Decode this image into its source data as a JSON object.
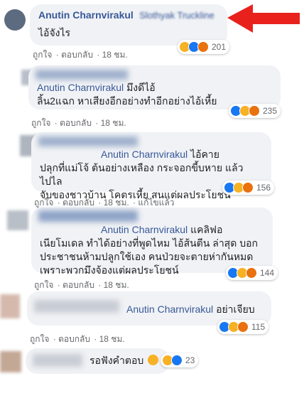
{
  "comments": [
    {
      "author": "Anutin Charnvirakul",
      "mention": "Slothyak Truckline",
      "text": "ไอ้จังไร",
      "actions": {
        "like": "ถูกใจ",
        "reply": "ตอบกลับ",
        "time": "18 ชม."
      },
      "reaction_count": "201"
    },
    {
      "author": "Slothyak Truckline",
      "mention": "Anutin Charnvirakul",
      "text_line1": "มึงดีไอ้",
      "text_line2": "ลิ้น2แฉก หาเสียงอีกอย่างทำอีกอย่างไอ้เหี้ย",
      "actions": {
        "like": "ถูกใจ",
        "reply": "ตอบกลับ",
        "time": "18 ชม."
      },
      "reaction_count": "235"
    },
    {
      "author": "Slothyak Truckline",
      "mention": "Anutin Charnvirakul",
      "text_line1": "ไอ้คาย",
      "text_line2": "ปลุกที่แม่โจ้ ต้นอย่างเหลือง กระจอกขี้บหาย แล้วไปไล",
      "text_line3": "จับของชาวบ้าน โคตรเหี้ย สนแต่ผลประโยชน์",
      "actions": {
        "like": "ถูกใจ",
        "reply": "ตอบกลับ",
        "time": "18 ชม.",
        "edited": "แก้ไขแล้ว"
      },
      "reaction_count": "156"
    },
    {
      "author": "Slothyak Truckline",
      "mention": "Anutin Charnvirakul",
      "text_line1": "แคลิฟอ",
      "text_line2": "เนียโมเดล ทำได้อย่างที่พูดไหม ไอ้ส้นตีน ล่าสุด บอก",
      "text_line3": "ประชาชนห้ามปลูกใช้เอง คนป่วยจะตายห่ากันหมด",
      "text_line4": "เพราะพวกมึงจ้องแต่ผลประโยชน์",
      "actions": {
        "like": "ถูกใจ",
        "reply": "ตอบกลับ",
        "time": "18 ชม."
      },
      "reaction_count": "144"
    },
    {
      "mention": "Anutin Charnvirakul",
      "text": "อย่าเจียบ",
      "actions": {
        "like": "ถูกใจ",
        "reply": "ตอบกลับ",
        "time": "18 ชม."
      },
      "reaction_count": "115"
    },
    {
      "text": "รอฟังคำตอบ",
      "reaction_count": "23"
    }
  ],
  "colors": {
    "arrow": "#e8211d",
    "name": "#385898",
    "bubble": "#f0f2f5",
    "meta": "#65676b"
  }
}
